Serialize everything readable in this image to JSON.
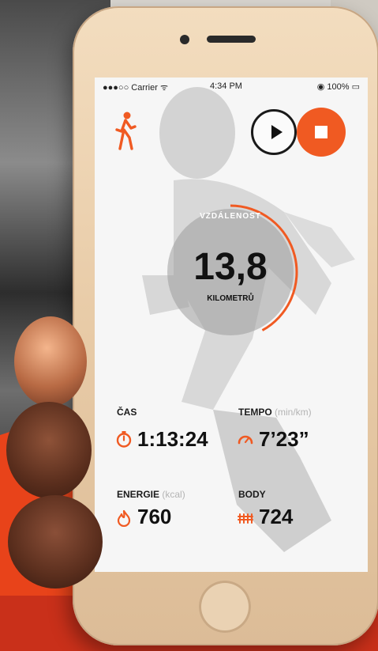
{
  "status_bar": {
    "carrier": "●●●○○ Carrier ᯤ",
    "time": "4:34 PM",
    "battery": "◉ 100% ▭"
  },
  "distance": {
    "label": "VZDÁLENOST",
    "value": "13,8",
    "unit": "KILOMETRŮ",
    "progress": 0.42
  },
  "stats": {
    "cas": {
      "label": "ČAS",
      "value": "1:13:24",
      "icon": "stopwatch-icon"
    },
    "tempo": {
      "label": "TEMPO",
      "unit": "(min/km)",
      "value": "7’23”",
      "icon": "speedometer-icon"
    },
    "energie": {
      "label": "ENERGIE",
      "unit": "(kcal)",
      "value": "760",
      "icon": "flame-icon"
    },
    "body": {
      "label": "BODY",
      "value": "724",
      "icon": "points-icon"
    }
  },
  "controls": {
    "activity_icon": "walking-person-icon",
    "play_icon": "play-icon",
    "stop_icon": "stop-icon"
  },
  "colors": {
    "accent": "#f05a22",
    "background": "#f6f6f6"
  }
}
